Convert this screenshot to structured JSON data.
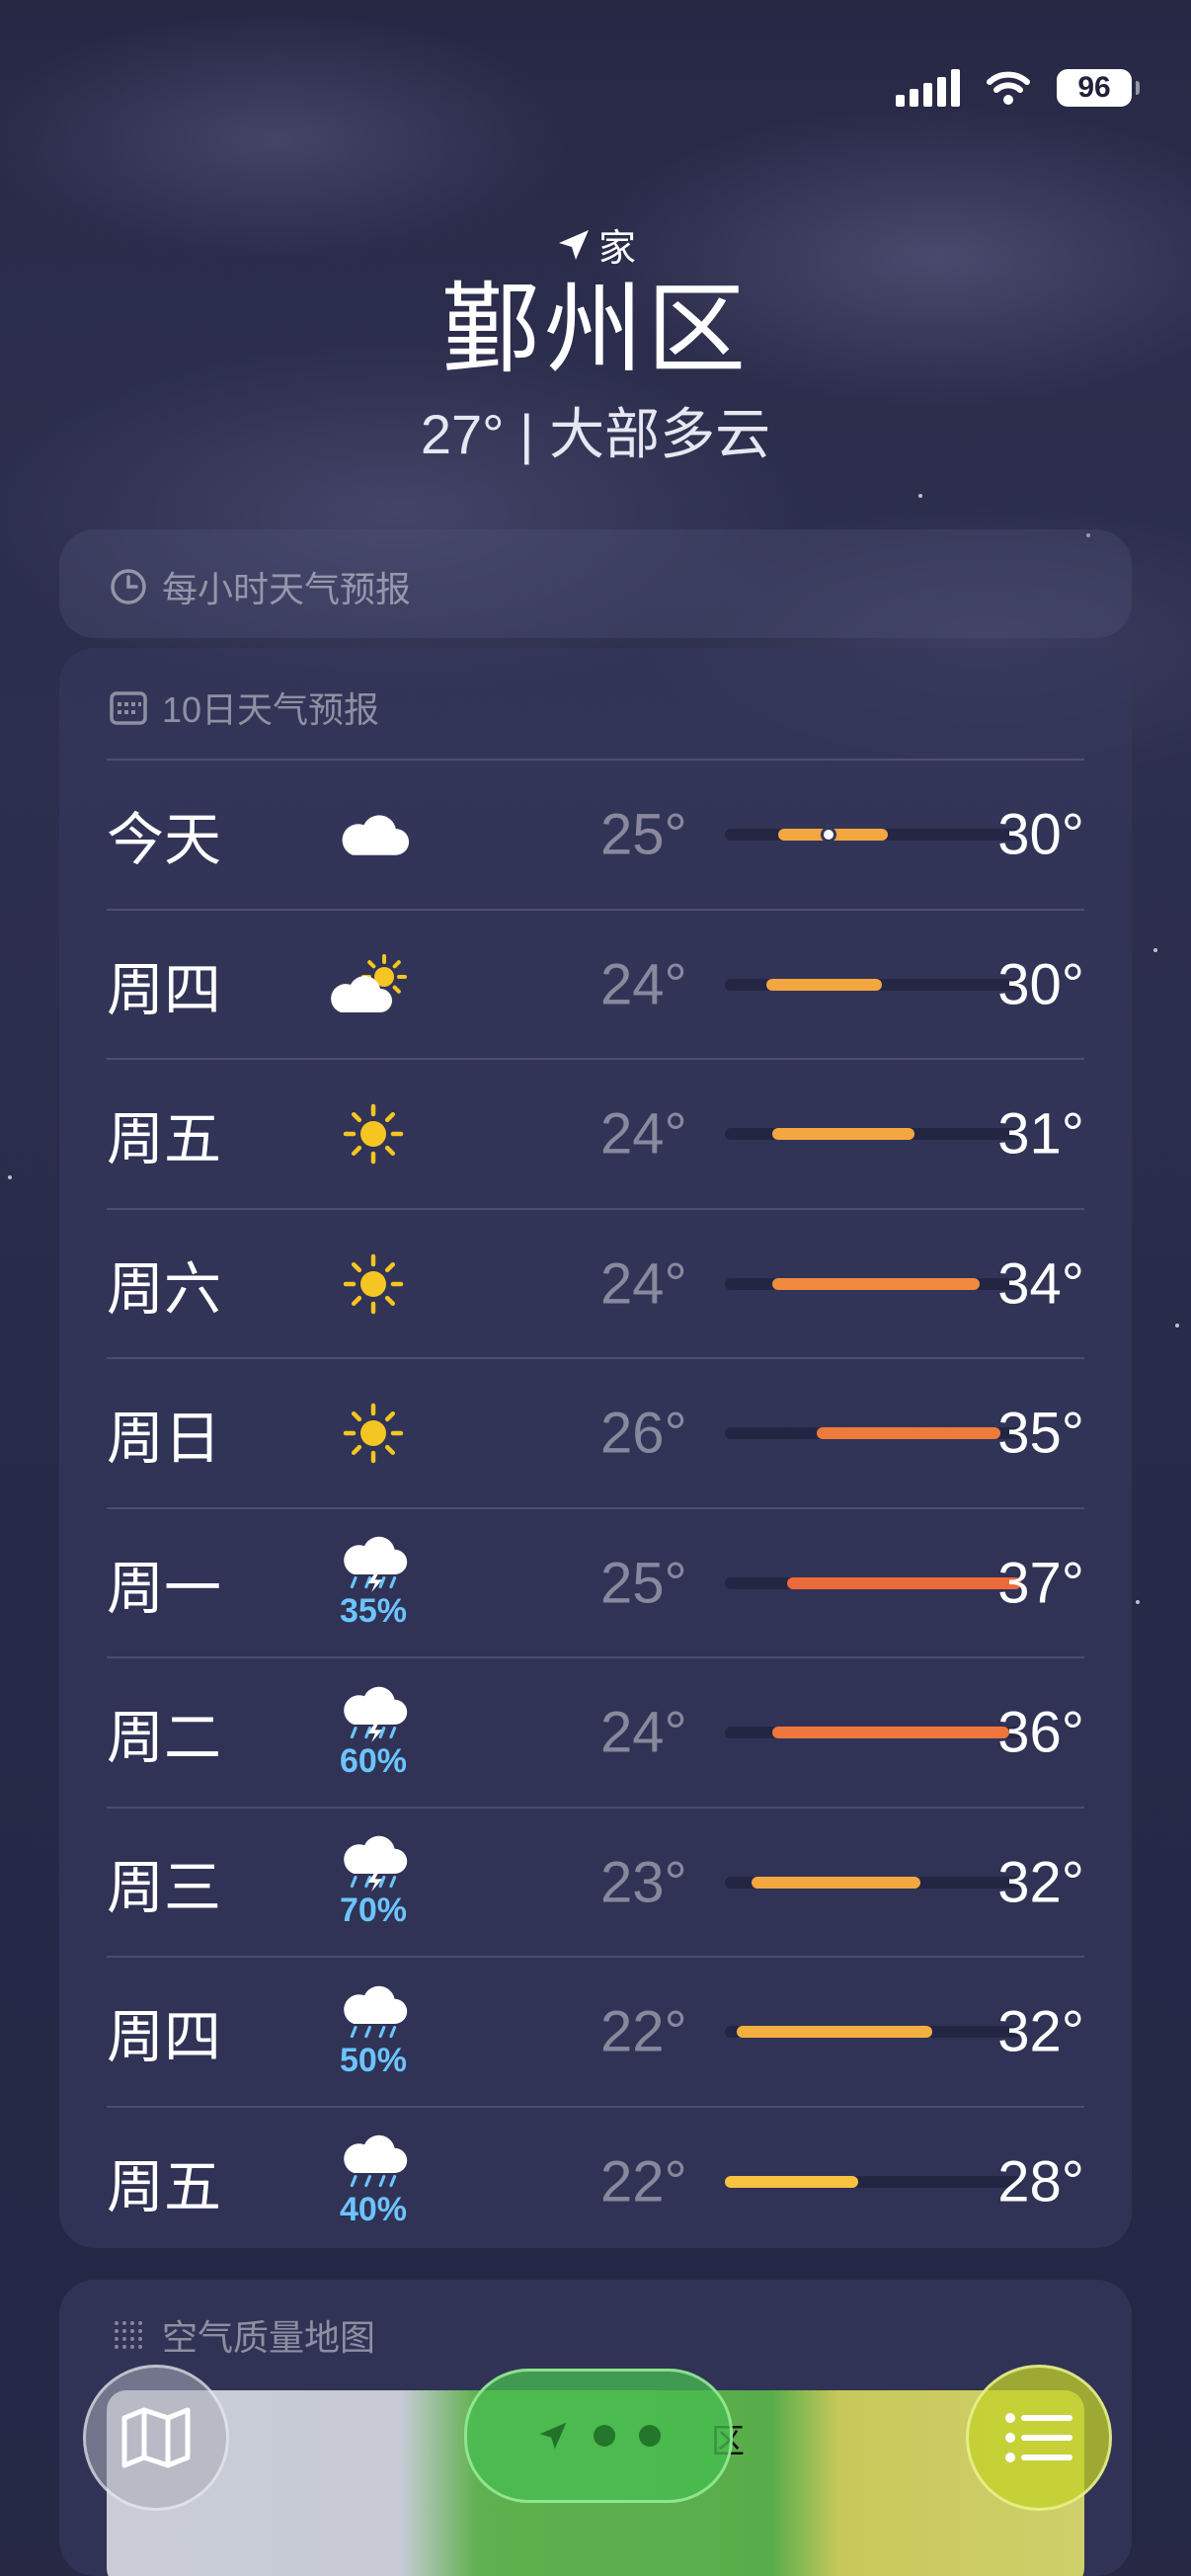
{
  "status_bar": {
    "battery": "96"
  },
  "location": {
    "label": "家",
    "city": "鄞州区",
    "summary": "27° | 大部多云"
  },
  "hourly": {
    "title": "每小时天气预报"
  },
  "daily": {
    "title": "10日天气预报",
    "days": [
      {
        "day": "今天",
        "icon": "cloud-icon",
        "precip": "",
        "low": "25°",
        "high": "30°",
        "bar_from": 0.18,
        "bar_to": 0.55,
        "current": 0.35,
        "bar_color": "#f4a640"
      },
      {
        "day": "周四",
        "icon": "partly-sunny-icon",
        "precip": "",
        "low": "24°",
        "high": "30°",
        "bar_from": 0.14,
        "bar_to": 0.53,
        "current": null,
        "bar_color": "#f4a640"
      },
      {
        "day": "周五",
        "icon": "sun-icon",
        "precip": "",
        "low": "24°",
        "high": "31°",
        "bar_from": 0.16,
        "bar_to": 0.64,
        "current": null,
        "bar_color": "#f4a640"
      },
      {
        "day": "周六",
        "icon": "sun-icon",
        "precip": "",
        "low": "24°",
        "high": "34°",
        "bar_from": 0.16,
        "bar_to": 0.86,
        "current": null,
        "bar_color": "#f08a3e"
      },
      {
        "day": "周日",
        "icon": "sun-icon",
        "precip": "",
        "low": "26°",
        "high": "35°",
        "bar_from": 0.31,
        "bar_to": 0.93,
        "current": null,
        "bar_color": "#ee7a3c"
      },
      {
        "day": "周一",
        "icon": "thunderstorm-icon",
        "precip": "35%",
        "low": "25°",
        "high": "37°",
        "bar_from": 0.21,
        "bar_to": 1.0,
        "current": null,
        "bar_color": "#ec6a3a"
      },
      {
        "day": "周二",
        "icon": "thunderstorm-icon",
        "precip": "60%",
        "low": "24°",
        "high": "36°",
        "bar_from": 0.16,
        "bar_to": 0.96,
        "current": null,
        "bar_color": "#ee763c"
      },
      {
        "day": "周三",
        "icon": "thunderstorm-icon",
        "precip": "70%",
        "low": "23°",
        "high": "32°",
        "bar_from": 0.09,
        "bar_to": 0.66,
        "current": null,
        "bar_color": "#f4a640"
      },
      {
        "day": "周四",
        "icon": "rain-icon",
        "precip": "50%",
        "low": "22°",
        "high": "32°",
        "bar_from": 0.04,
        "bar_to": 0.7,
        "current": null,
        "bar_color": "#f4b03f"
      },
      {
        "day": "周五",
        "icon": "rain-icon",
        "precip": "40%",
        "low": "22°",
        "high": "28°",
        "bar_from": 0.0,
        "bar_to": 0.45,
        "current": null,
        "bar_color": "#f6c240"
      }
    ]
  },
  "air_quality": {
    "title": "空气质量地图",
    "map_label": "区"
  }
}
